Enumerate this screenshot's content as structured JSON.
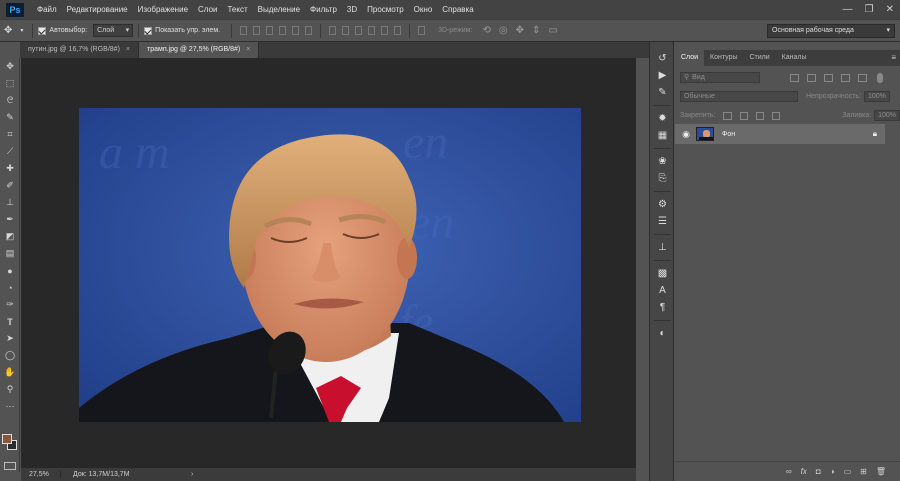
{
  "app": {
    "logo": "Ps"
  },
  "menu": [
    "Файл",
    "Редактирование",
    "Изображение",
    "Слои",
    "Текст",
    "Выделение",
    "Фильтр",
    "3D",
    "Просмотр",
    "Окно",
    "Справка"
  ],
  "window_controls": {
    "minimize": "—",
    "restore": "❐",
    "close": "✕"
  },
  "options": {
    "autoselect_label": "Автовыбор:",
    "autoselect_checked": true,
    "autoselect_target": "Слой",
    "show_transform_label": "Показать упр. элем.",
    "show_transform_checked": true,
    "mode_3d_label": "3D-режим:",
    "workspace": "Основная рабочая среда"
  },
  "tabs": [
    {
      "label": "путин.jpg @ 16,7% (RGB/8#)",
      "active": false
    },
    {
      "label": "трамп.jpg @ 27,5% (RGB/8#)",
      "active": true
    }
  ],
  "tab_close": "×",
  "status": {
    "zoom": "27,5%",
    "doc": "Док: 13,7M/13,7M",
    "arrow": "›"
  },
  "tools": [
    "move-tool",
    "marquee-tool",
    "lasso-tool",
    "quick-select-tool",
    "crop-tool",
    "eyedropper-tool",
    "healing-tool",
    "brush-tool",
    "stamp-tool",
    "history-brush-tool",
    "eraser-tool",
    "gradient-tool",
    "blur-tool",
    "dodge-tool",
    "pen-tool",
    "text-tool",
    "path-select-tool",
    "shape-tool",
    "hand-tool",
    "zoom-tool",
    "more-tools"
  ],
  "colors": {
    "foreground": "#87563c",
    "background": "#2a2a2a",
    "photo_bg": "#274a96"
  },
  "layers_panel": {
    "tabs": [
      "Слои",
      "Контуры",
      "Стили",
      "Каналы"
    ],
    "active_tab": "Слои",
    "filter_kind": "Вид",
    "blend_mode": "Обычные",
    "opacity_label": "Непрозрачность:",
    "opacity_value": "100%",
    "lock_label": "Закрепить:",
    "fill_label": "Заливка:",
    "fill_value": "100%",
    "layers": [
      {
        "name": "Фон",
        "visible": true,
        "locked": true
      }
    ]
  }
}
